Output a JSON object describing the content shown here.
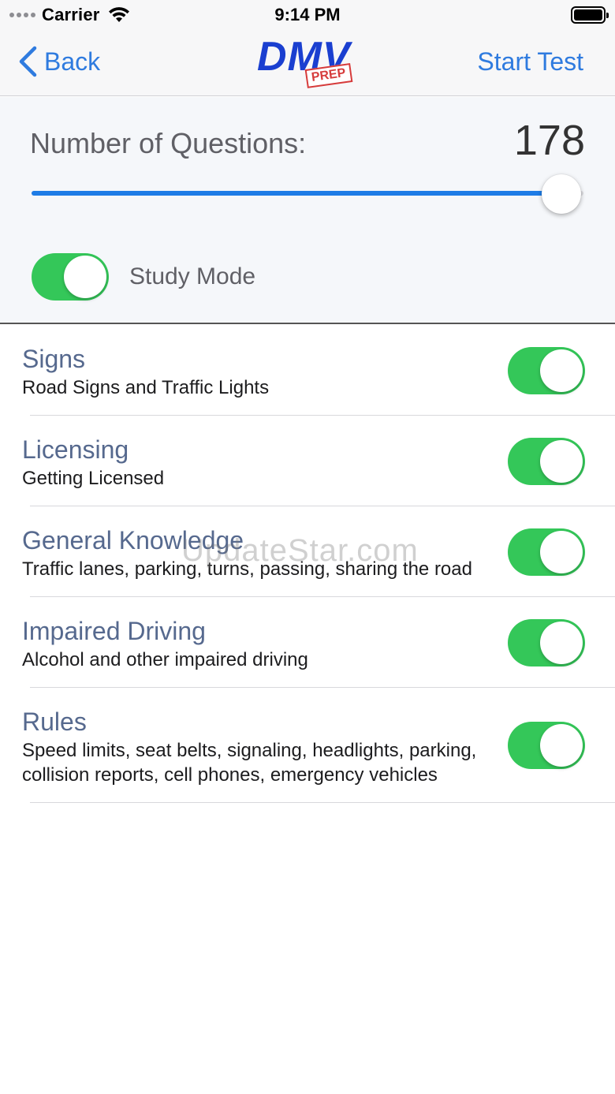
{
  "status_bar": {
    "carrier": "Carrier",
    "time": "9:14 PM"
  },
  "nav": {
    "back_label": "Back",
    "logo_text": "DMV",
    "logo_badge": "PREP",
    "start_label": "Start Test"
  },
  "settings": {
    "questions_label": "Number of Questions:",
    "questions_value": "178",
    "slider_fraction": 0.96,
    "study_mode_label": "Study Mode",
    "study_mode_on": true
  },
  "categories": [
    {
      "title": "Signs",
      "description": "Road Signs and Traffic Lights",
      "enabled": true
    },
    {
      "title": "Licensing",
      "description": "Getting Licensed",
      "enabled": true
    },
    {
      "title": "General Knowledge",
      "description": "Traffic lanes, parking, turns, passing, sharing the road",
      "enabled": true
    },
    {
      "title": "Impaired Driving",
      "description": "Alcohol and other impaired driving",
      "enabled": true
    },
    {
      "title": "Rules",
      "description": "Speed limits, seat belts, signaling, headlights, parking, collision reports, cell phones, emergency vehicles",
      "enabled": true
    }
  ],
  "watermark": "UpdateStar.com",
  "colors": {
    "accent": "#2f7bdf",
    "toggle_on": "#34c759",
    "slider_fill": "#1e7ce6",
    "category_title": "#56698e",
    "logo_blue": "#1a3fd0",
    "logo_red": "#d63b3b"
  }
}
